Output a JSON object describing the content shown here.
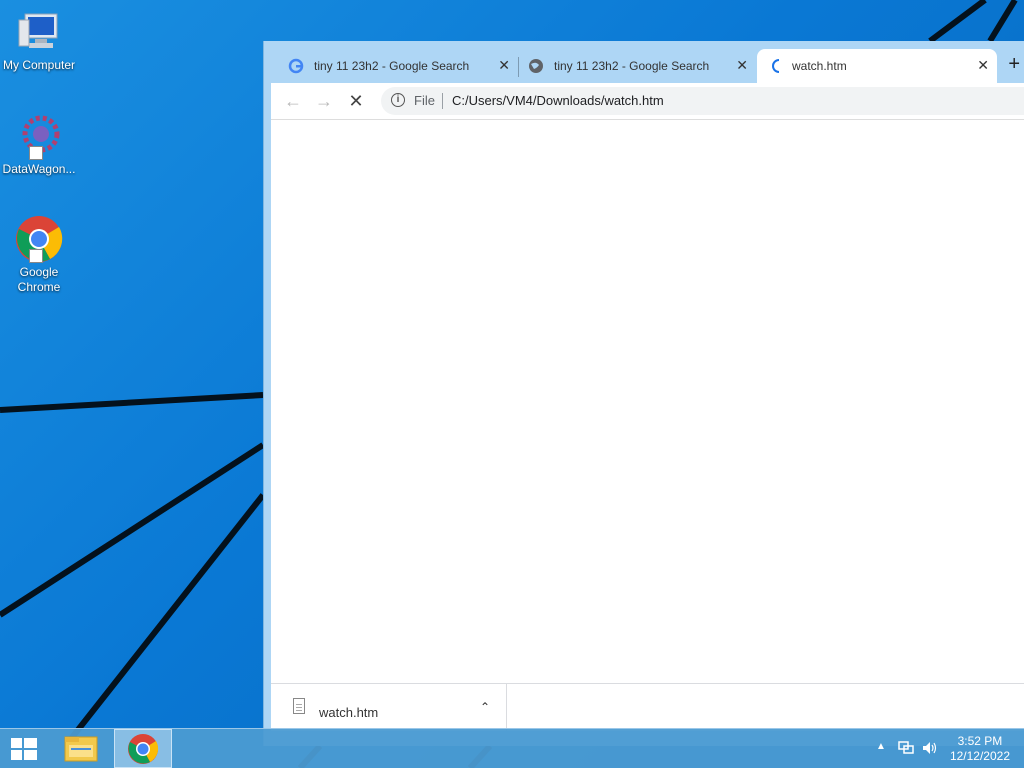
{
  "desktop": {
    "icons": [
      {
        "label": "My Computer"
      },
      {
        "label": "DataWagon..."
      },
      {
        "label": "Google Chrome"
      }
    ]
  },
  "browser": {
    "tabs": [
      {
        "title": "tiny 11 23h2 - Google Search",
        "favicon": "google-g-icon"
      },
      {
        "title": "tiny 11 23h2 - Google Search",
        "favicon": "globe-icon"
      },
      {
        "title": "watch.htm",
        "favicon": "loading-spinner-icon",
        "active": true
      }
    ],
    "newtab": "+",
    "close_glyph": "✕",
    "omnibox": {
      "scheme": "File",
      "url": "C:/Users/VM4/Downloads/watch.htm"
    },
    "download": {
      "filename": "watch.htm"
    }
  },
  "taskbar": {
    "time": "3:52 PM",
    "date": "12/12/2022"
  },
  "colors": {
    "desktop": "#0a78d4",
    "tabstrip": "#aed6f5",
    "taskbar": "#4b9bd2"
  }
}
